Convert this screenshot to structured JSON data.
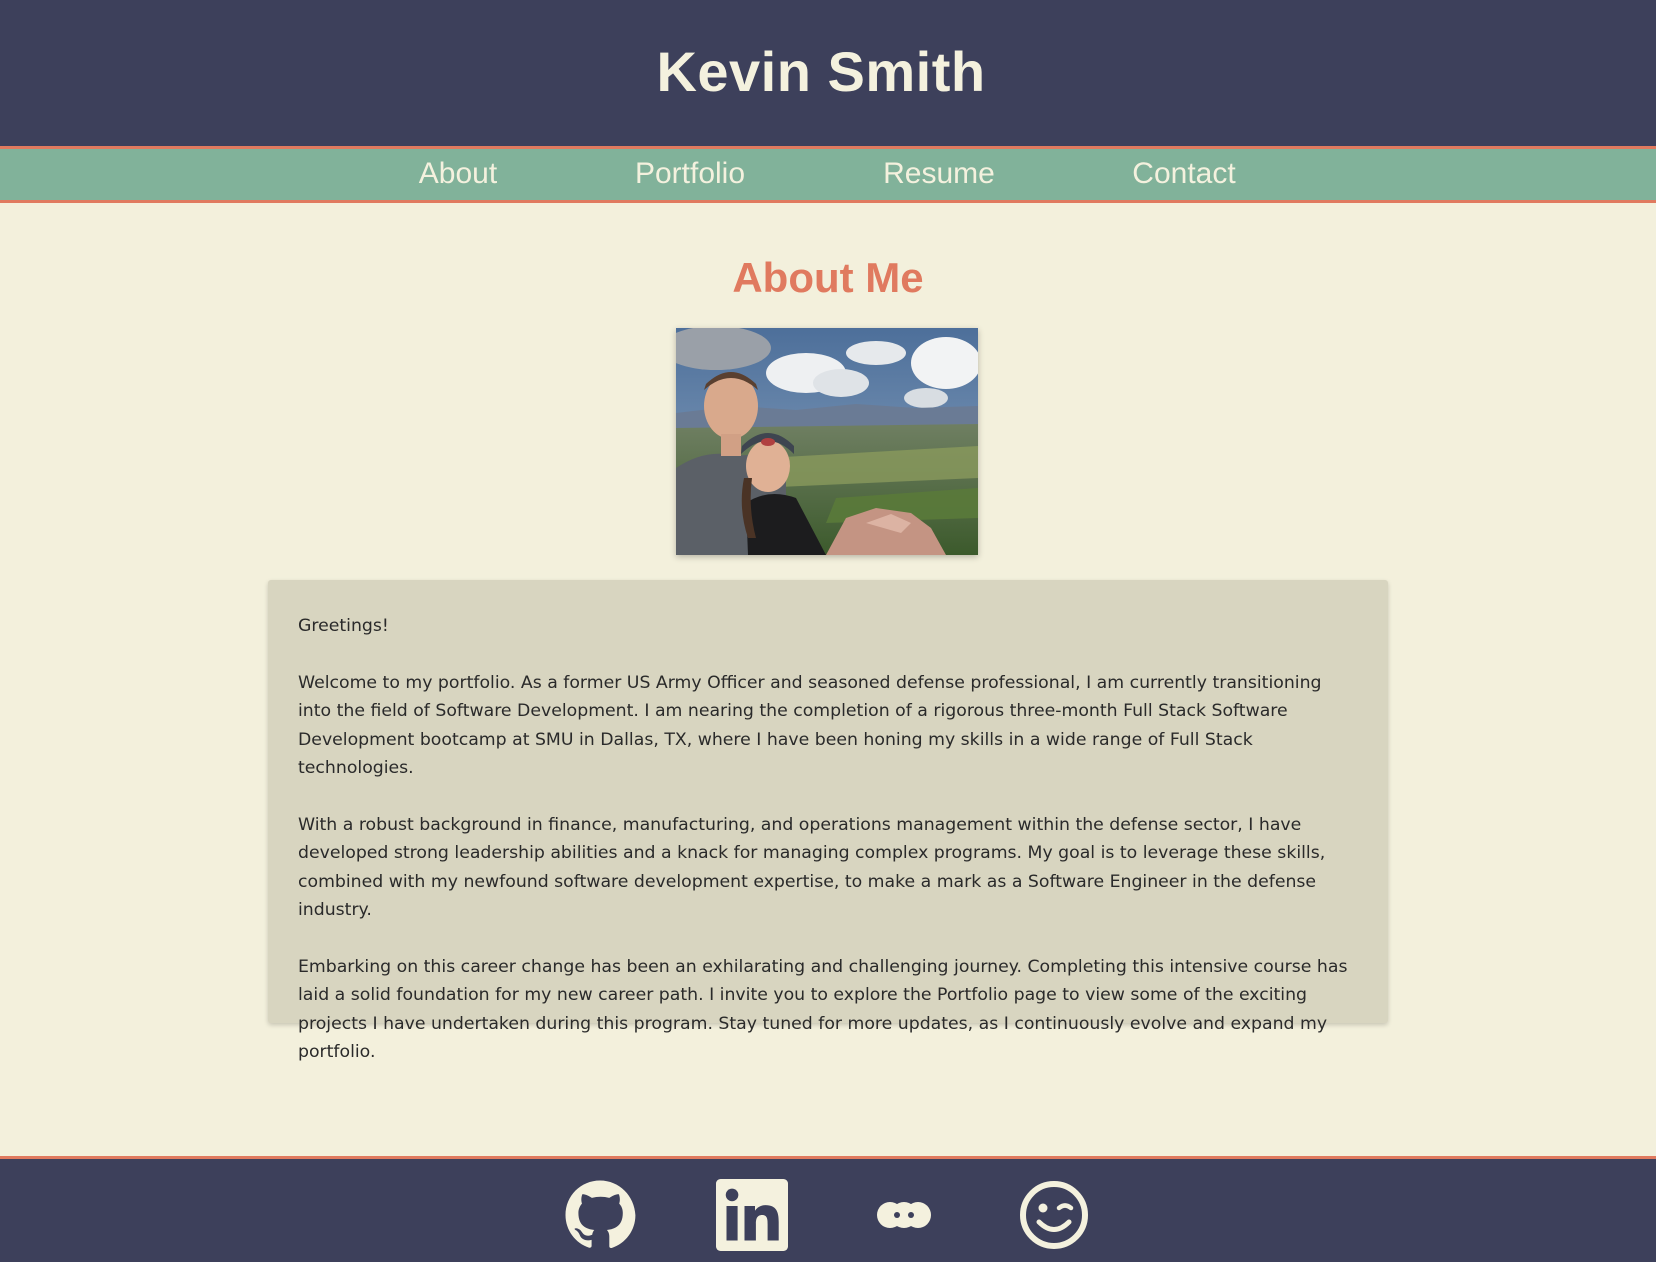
{
  "header": {
    "name": "Kevin Smith"
  },
  "nav": {
    "items": [
      {
        "label": "About"
      },
      {
        "label": "Portfolio"
      },
      {
        "label": "Resume"
      },
      {
        "label": "Contact"
      }
    ]
  },
  "about": {
    "title": "About Me",
    "paragraphs": [
      "Greetings!",
      "Welcome to my portfolio. As a former US Army Officer and seasoned defense professional, I am currently transitioning into the field of Software Development. I am nearing the completion of a rigorous three-month Full Stack Software Development bootcamp at SMU in Dallas, TX, where I have been honing my skills in a wide range of Full Stack technologies.",
      "With a robust background in finance, manufacturing, and operations management within the defense sector, I have developed strong leadership abilities and a knack for managing complex programs. My goal is to leverage these skills, combined with my newfound software development expertise, to make a mark as a Software Engineer in the defense industry.",
      "Embarking on this career change has been an exhilarating and challenging journey. Completing this intensive course has laid a solid foundation for my new career path. I invite you to explore the Portfolio page to view some of the exciting projects I have undertaken during this program. Stay tuned for more updates, as I continuously evolve and expand my portfolio."
    ]
  },
  "footer": {
    "icons": [
      "github-icon",
      "linkedin-icon",
      "flickr-icon",
      "wink-smiley-icon"
    ]
  },
  "colors": {
    "navy": "#3d405b",
    "cream": "#f4f1de",
    "sage": "#81b29a",
    "terracotta": "#e07a5f",
    "card": "#d8d5c0"
  }
}
